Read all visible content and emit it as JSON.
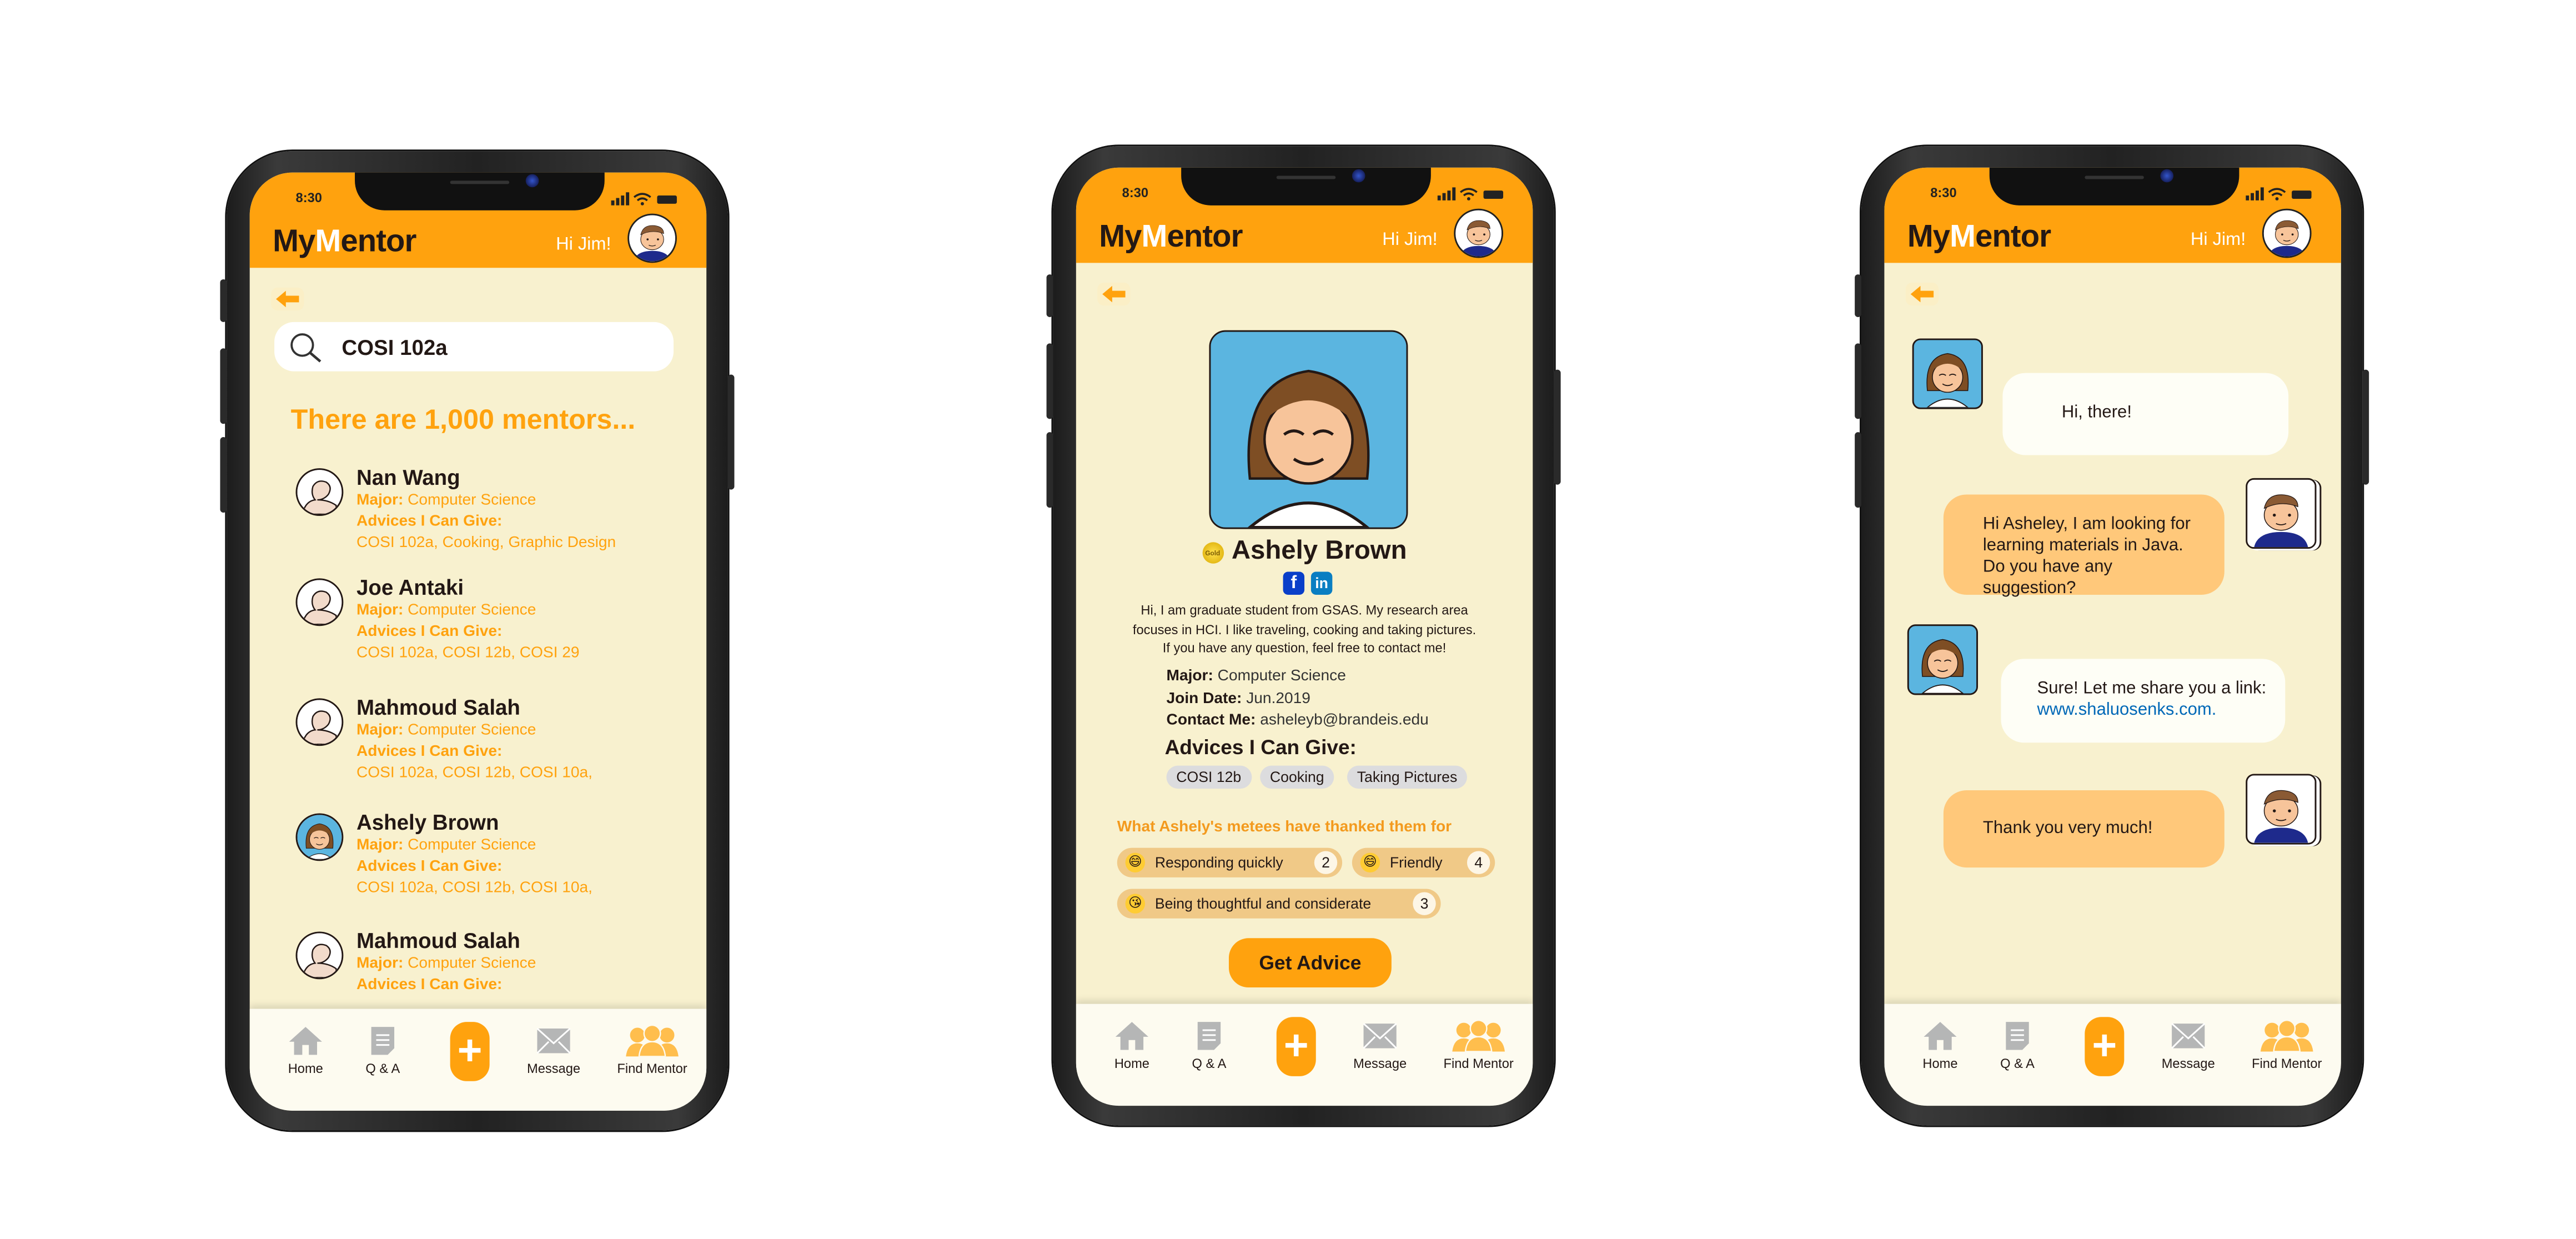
{
  "common": {
    "status_time": "8:30",
    "logo_prefix": "My",
    "logo_m": "M",
    "logo_suffix": "entor",
    "greeting": "Hi Jim!",
    "nav": [
      {
        "label": "Home",
        "icon": "home-icon"
      },
      {
        "label": "Q & A",
        "icon": "document-icon"
      },
      {
        "label": "+",
        "icon": "plus-icon"
      },
      {
        "label": "Message",
        "icon": "envelope-icon"
      },
      {
        "label": "Find Mentor",
        "icon": "people-icon"
      }
    ],
    "colors": {
      "brand": "#FFA20E",
      "background": "#F8F1CF",
      "active_nav": "#FFBE4D",
      "inactive_nav": "#B5B6B6"
    }
  },
  "search_screen": {
    "query": "COSI 102a",
    "result_heading": "There are 1,000 mentors...",
    "major_label": "Major:",
    "advice_label": "Advices I Can Give:",
    "mentors": [
      {
        "name": "Nan Wang",
        "major": "Computer Science",
        "advices": "COSI 102a, Cooking, Graphic Design",
        "avatar": "placeholder"
      },
      {
        "name": "Joe Antaki",
        "major": "Computer Science",
        "advices": "COSI 102a, COSI 12b, COSI 29",
        "avatar": "placeholder"
      },
      {
        "name": "Mahmoud Salah",
        "major": "Computer Science",
        "advices": "COSI 102a, COSI 12b, COSI 10a,",
        "avatar": "placeholder"
      },
      {
        "name": "Ashely Brown",
        "major": "Computer Science",
        "advices": "COSI 102a, COSI 12b, COSI 10a,",
        "avatar": "photo"
      },
      {
        "name": "Mahmoud Salah",
        "major": "Computer Science",
        "advices": "",
        "avatar": "placeholder"
      }
    ]
  },
  "profile_screen": {
    "badge": "Gold",
    "name": "Ashely Brown",
    "social": [
      "facebook",
      "linkedin"
    ],
    "bio": [
      "Hi, I am graduate student from GSAS. My research area",
      "focuses in HCI. I like traveling, cooking and taking pictures.",
      "If you have any question, feel free to contact me!"
    ],
    "major_label": "Major:",
    "major": "Computer Science",
    "join_label": "Join Date:",
    "join": "Jun.2019",
    "contact_label": "Contact Me:",
    "contact": "asheleyb@brandeis.edu",
    "advice_heading": "Advices I Can Give:",
    "advices": [
      "COSI 12b",
      "Cooking",
      "Taking Pictures"
    ],
    "thanks_heading": "What Ashely's metees have thanked them for",
    "thanks": [
      {
        "label": "Responding quickly",
        "count": "2"
      },
      {
        "label": "Friendly",
        "count": "4"
      },
      {
        "label": "Being thoughtful and considerate",
        "count": "3"
      }
    ],
    "cta": "Get Advice"
  },
  "chat_screen": {
    "messages": [
      {
        "from": "mentor",
        "text": "Hi, there!"
      },
      {
        "from": "me",
        "text": "Hi Asheley, I am looking for learning materials in Java. Do you have any suggestion?"
      },
      {
        "from": "mentor",
        "text": "Sure! Let me share you a link:",
        "link": "www.shaluosenks.com."
      },
      {
        "from": "me",
        "text": "Thank you very much!"
      }
    ]
  }
}
